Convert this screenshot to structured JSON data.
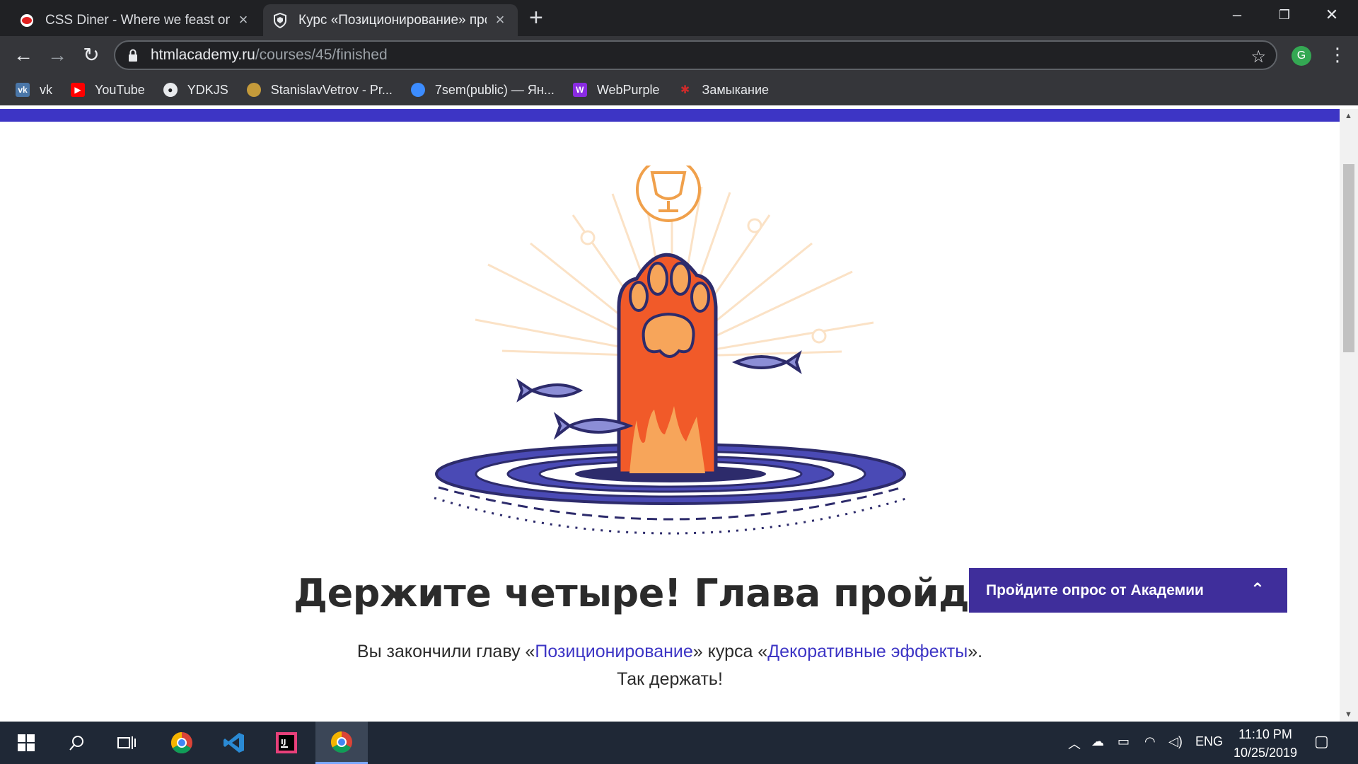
{
  "browser": {
    "tabs": [
      {
        "title": "CSS Diner - Where we feast on CSS Selectors!",
        "active": false,
        "favicon": "css-diner-icon"
      },
      {
        "title": "Курс «Позиционирование» про",
        "active": true,
        "favicon": "htmlacademy-shield-icon"
      }
    ],
    "url_host": "htmlacademy.ru",
    "url_path": "/courses/45/finished",
    "profile_initial": "G",
    "bookmarks": [
      {
        "label": "vk",
        "icon": "vk-icon",
        "color": "#4a76a8"
      },
      {
        "label": "YouTube",
        "icon": "youtube-icon",
        "color": "#ff0000"
      },
      {
        "label": "YDKJS",
        "icon": "github-icon",
        "color": "#e8eaed"
      },
      {
        "label": "StanislavVetrov - Pr...",
        "icon": "avatar-icon",
        "color": "#c49a3a"
      },
      {
        "label": "7sem(public) — Ян...",
        "icon": "yandex-disk-icon",
        "color": "#3c8cff"
      },
      {
        "label": "WebPurple",
        "icon": "webpurple-icon",
        "color": "#8a2be2"
      },
      {
        "label": "Замыкание",
        "icon": "closure-icon",
        "color": "#d12a2a"
      }
    ]
  },
  "page": {
    "heading": "Держите четыре! Глава пройдена",
    "desc_prefix": "Вы закончили главу «",
    "chapter_link": "Позиционирование",
    "desc_middle": "» курса «",
    "course_link": "Декоративные эффекты",
    "desc_suffix": "».",
    "desc_line2": "Так держать!",
    "survey_label": "Пройдите опрос от Академии",
    "accent": "#3d35c5"
  },
  "taskbar": {
    "language": "ENG",
    "time": "11:10 PM",
    "date": "10/25/2019"
  }
}
